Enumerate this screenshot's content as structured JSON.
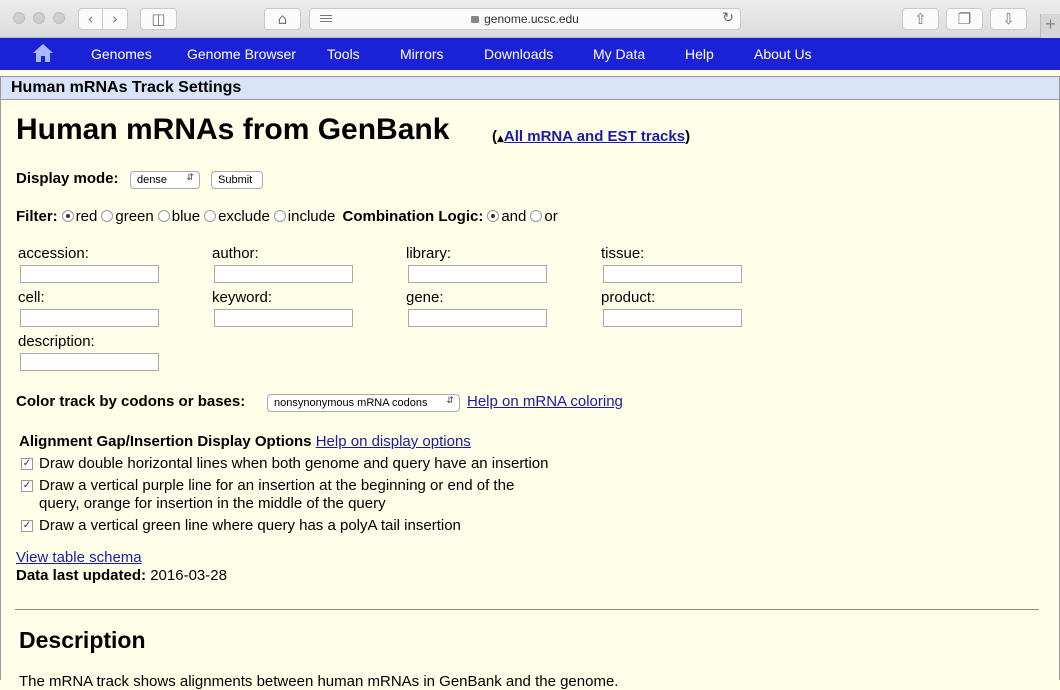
{
  "browser": {
    "url": "genome.ucsc.edu",
    "icons": [
      "back-icon",
      "forward-icon",
      "sidebar-icon",
      "home-icon",
      "reader-icon",
      "lock-icon",
      "reload-icon",
      "share-icon",
      "tabs-icon",
      "download-icon",
      "new-tab-icon"
    ]
  },
  "nav": {
    "items": [
      "Genomes",
      "Genome Browser",
      "Tools",
      "Mirrors",
      "Downloads",
      "My Data",
      "Help",
      "About Us"
    ],
    "accent": "#1b21d6"
  },
  "panel": {
    "header": "Human mRNAs Track Settings"
  },
  "page": {
    "title": "Human mRNAs from GenBank",
    "paren_open": "(",
    "paren_close": ")",
    "all_tracks_link": "All mRNA and EST tracks",
    "display_mode_label": "Display mode:",
    "display_mode_value": "dense",
    "submit_label": "Submit",
    "filter_label": "Filter:",
    "filter_options": [
      "red",
      "green",
      "blue",
      "exclude",
      "include"
    ],
    "filter_selected": "red",
    "combination_label": "Combination Logic:",
    "combination_options": [
      "and",
      "or"
    ],
    "combination_selected": "and",
    "fields": [
      "accession:",
      "author:",
      "library:",
      "tissue:",
      "cell:",
      "keyword:",
      "gene:",
      "product:",
      "description:"
    ],
    "color_label": "Color track by codons or bases:",
    "color_value": "nonsynonymous mRNA codons",
    "color_help_link": "Help on mRNA coloring",
    "gap_title": "Alignment Gap/Insertion Display Options",
    "gap_help_link": "Help on display options",
    "gap_options": [
      "Draw double horizontal lines when both genome and query have an insertion",
      "Draw a vertical purple line for an insertion at the beginning or end of the",
      "query, orange for insertion in the middle of the query",
      "Draw a vertical green line where query has a polyA tail insertion"
    ],
    "schema_link": "View table schema",
    "updated_label": "Data last updated:",
    "updated_value": "2016-03-28",
    "description_heading": "Description",
    "description_text": "The mRNA track shows alignments between human mRNAs in GenBank and the genome."
  }
}
